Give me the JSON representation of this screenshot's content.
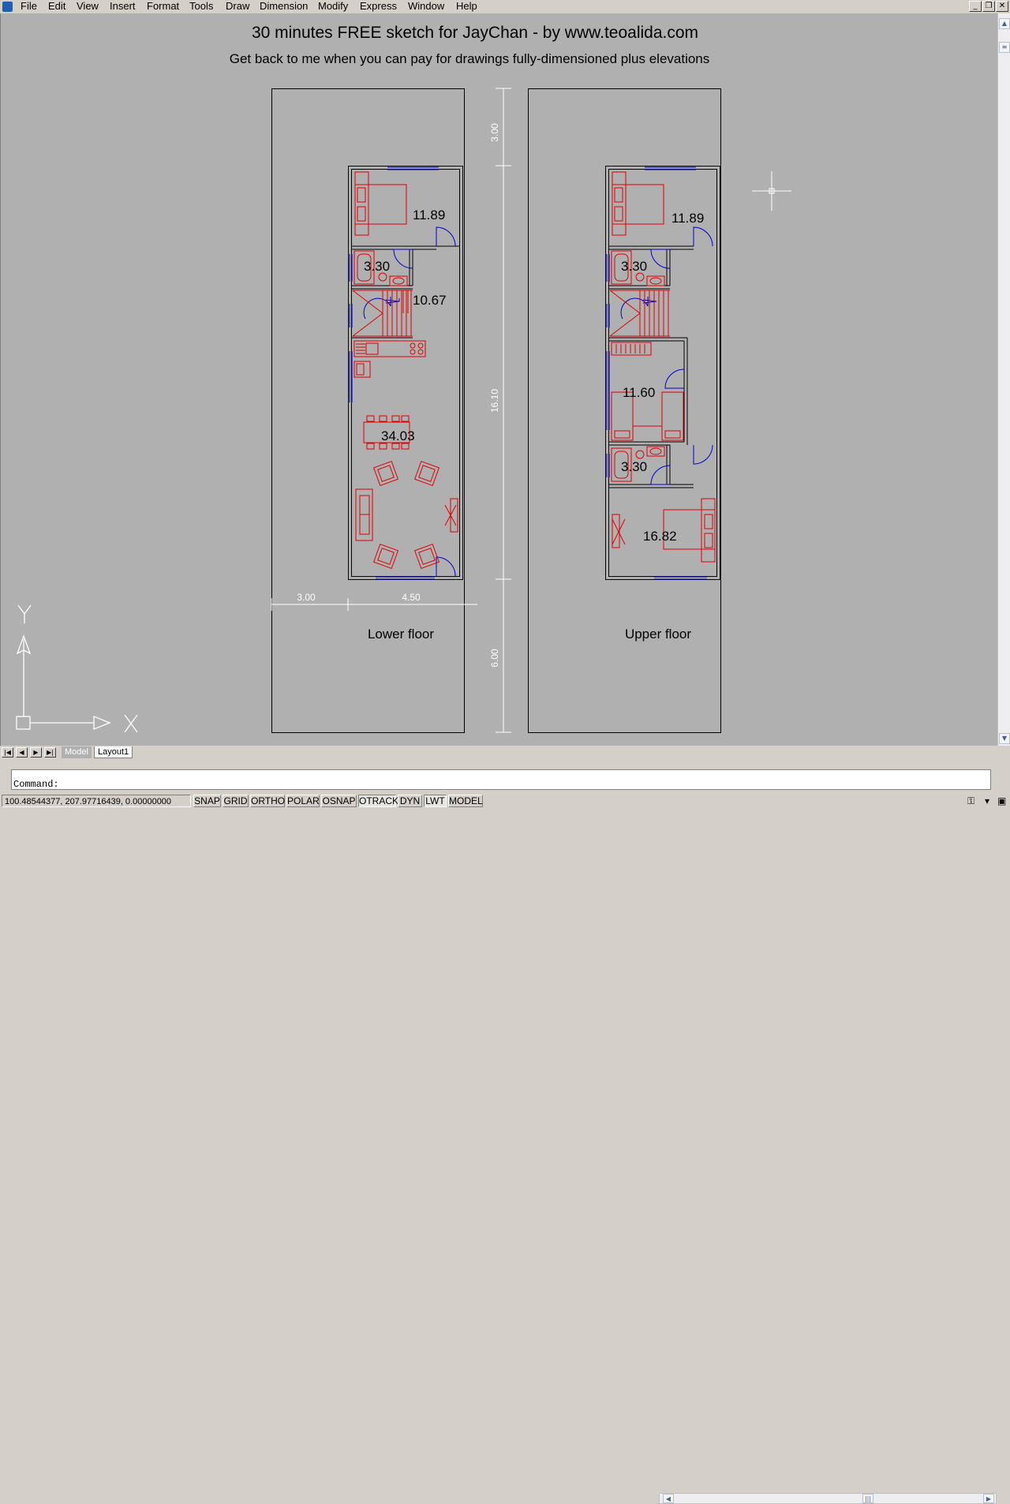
{
  "menu": [
    "File",
    "Edit",
    "View",
    "Insert",
    "Format",
    "Tools",
    "Draw",
    "Dimension",
    "Modify",
    "Express",
    "Window",
    "Help"
  ],
  "drawing": {
    "title": "30 minutes FREE sketch for JayChan - by www.teoalida.com",
    "subtitle": "Get back to me when you can pay for drawings fully-dimensioned plus elevations",
    "lower_label": "Lower floor",
    "upper_label": "Upper floor",
    "lower_areas": [
      "11.89",
      "3.30",
      "10.67",
      "34.03"
    ],
    "upper_areas": [
      "11.89",
      "3.30",
      "11.60",
      "3.30",
      "16.82"
    ],
    "dim_top": "3.00",
    "dim_middle": "16.10",
    "dim_bottom": "6.00",
    "dim_left": "3.00",
    "dim_right": "4.50",
    "ucs_x": "X",
    "ucs_y": "Y"
  },
  "tabs": {
    "model": "Model",
    "layout1": "Layout1"
  },
  "command": {
    "prompt": "Command:"
  },
  "status": {
    "coords": "100.48544377, 207.97716439, 0.00000000",
    "buttons": [
      "SNAP",
      "GRID",
      "ORTHO",
      "POLAR",
      "OSNAP",
      "OTRACK",
      "DYN",
      "LWT",
      "MODEL"
    ]
  },
  "colors": {
    "canvas": "#b0b0b0",
    "furniture": "#e00000",
    "doors": "#0000d0",
    "walls": "#000000",
    "dimensions": "#ffffff"
  }
}
